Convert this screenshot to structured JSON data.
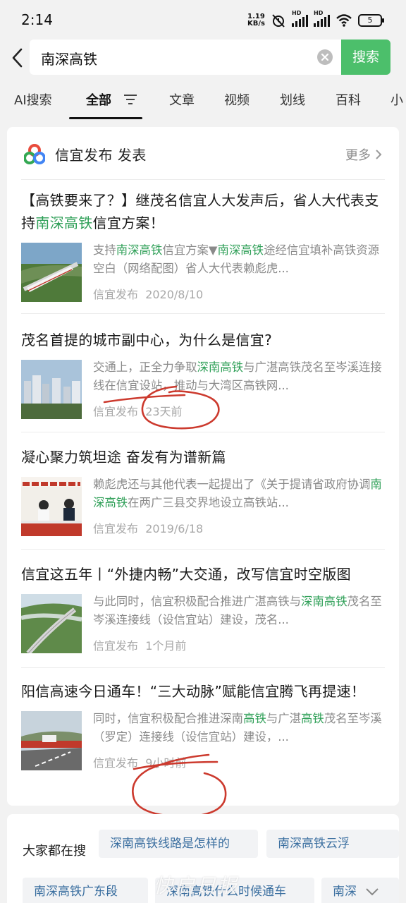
{
  "status": {
    "time": "2:14",
    "netspeed_value": "1.19",
    "netspeed_unit": "KB/s",
    "battery": "5"
  },
  "search": {
    "query": "南深高铁",
    "button_label": "搜索"
  },
  "tabs": [
    "AI搜索",
    "全部",
    "文章",
    "视频",
    "划线",
    "百科",
    "小"
  ],
  "publisher": {
    "title": "信宜发布 发表",
    "more_label": "更多"
  },
  "articles": [
    {
      "title_parts": [
        "【高铁要来了？】继茂名信宜人大发声后，省人大代表支持",
        "南深高铁",
        "信宜方案！"
      ],
      "snippet_parts": [
        "支持",
        "南深高铁",
        "信宜方案▼",
        "南深高铁",
        "途经信宜填补高铁资源空白（网络配图）省人大代表赖彪虎..."
      ],
      "source": "信宜发布",
      "date": "2020/8/10"
    },
    {
      "title_parts": [
        "茂名首提的城市副中心，为什么是信宜?"
      ],
      "snippet_parts": [
        "交通上，正全力争取",
        "深南高铁",
        "与广湛高铁茂名至岑溪连接线在信宜设站，推动与大湾区高铁网..."
      ],
      "source": "信宜发布",
      "date": "23天前"
    },
    {
      "title_parts": [
        "凝心聚力筑坦途 奋发有为谱新篇"
      ],
      "snippet_parts": [
        "赖彪虎还与其他代表一起提出了《关于提请省政府协调",
        "南深高铁",
        "在两广三县交界地设立高铁站..."
      ],
      "source": "信宜发布",
      "date": "2019/6/18"
    },
    {
      "title_parts": [
        "信宜这五年丨“外捷内畅”大交通，改写信宜时空版图"
      ],
      "snippet_parts": [
        "与此同时，信宜积极配合推进广湛高铁与",
        "深南高铁",
        "茂名至岑溪连接线（设信宜站）建设，茂名..."
      ],
      "source": "信宜发布",
      "date": "1个月前"
    },
    {
      "title_parts": [
        "阳信高速今日通车！“三大动脉”赋能信宜腾飞再提速！"
      ],
      "snippet_parts": [
        "同时，信宜积极配合推进深南",
        "高铁",
        "与广湛",
        "高铁",
        "茂名至岑溪（罗定）连接线（设信宜站）建设，..."
      ],
      "source": "信宜发布",
      "date": "9小时前"
    }
  ],
  "popular": {
    "label": "大家都在搜",
    "chips": [
      "深南高铁线路是怎样的",
      "南深高铁云浮",
      "南深高铁广东段",
      "深南高铁什么时候通车",
      "南深"
    ]
  },
  "watermark": "快启日报",
  "colors": {
    "accent_green": "#4cbf6b",
    "highlight_green": "#2e9f57",
    "annotation_red": "#cc3a2e"
  }
}
